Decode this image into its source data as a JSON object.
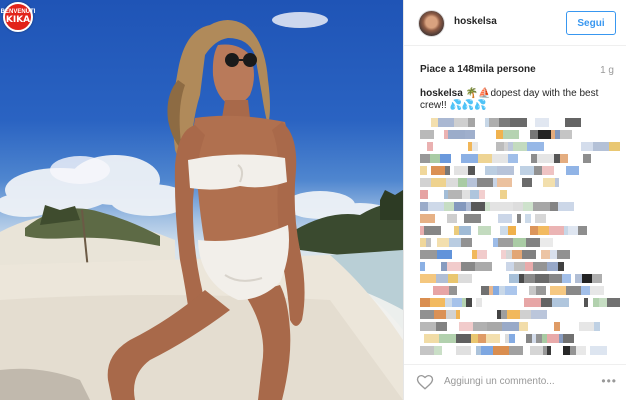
{
  "watermark": {
    "line1": "BENVENUTI",
    "line2": "KIKA"
  },
  "post": {
    "username": "hoskelsa",
    "follow_label": "Segui",
    "likes_text": "Piace a 148mila persone",
    "age": "1 g",
    "caption_user": "hoskelsa",
    "caption_emoji": "🌴⛵",
    "caption_text": "dopest day with the best crew!!",
    "caption_drops": "💦💦💦",
    "comment_placeholder": "Aggiungi un commento...",
    "more_label": "•••"
  },
  "colors": {
    "accent": "#3897f0",
    "watermark": "#e2231a"
  }
}
